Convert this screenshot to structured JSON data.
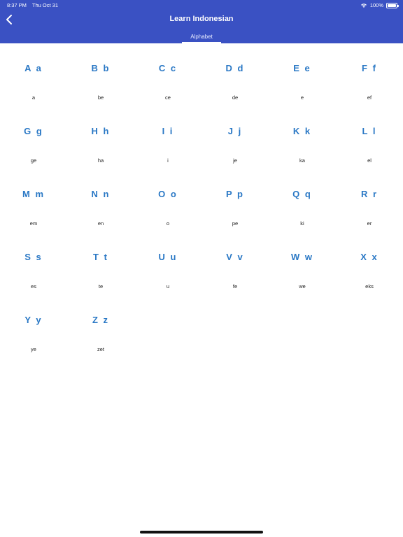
{
  "status": {
    "time": "8:37 PM",
    "date": "Thu Oct 31",
    "battery": "100%"
  },
  "header": {
    "title": "Learn Indonesian",
    "tab": "Alphabet"
  },
  "icons": {
    "back": "chevron-left-icon",
    "wifi": "wifi-icon",
    "battery": "battery-icon"
  },
  "colors": {
    "header_bg": "#3a51c3",
    "letter": "#2a78c5"
  },
  "alphabet": [
    {
      "letter": "A a",
      "pron": "a"
    },
    {
      "letter": "B b",
      "pron": "be"
    },
    {
      "letter": "C c",
      "pron": "ce"
    },
    {
      "letter": "D d",
      "pron": "de"
    },
    {
      "letter": "E e",
      "pron": "e"
    },
    {
      "letter": "F f",
      "pron": "ef"
    },
    {
      "letter": "G g",
      "pron": "ge"
    },
    {
      "letter": "H h",
      "pron": "ha"
    },
    {
      "letter": "I i",
      "pron": "i"
    },
    {
      "letter": "J j",
      "pron": "je"
    },
    {
      "letter": "K k",
      "pron": "ka"
    },
    {
      "letter": "L l",
      "pron": "el"
    },
    {
      "letter": "M m",
      "pron": "em"
    },
    {
      "letter": "N n",
      "pron": "en"
    },
    {
      "letter": "O o",
      "pron": "o"
    },
    {
      "letter": "P p",
      "pron": "pe"
    },
    {
      "letter": "Q q",
      "pron": "ki"
    },
    {
      "letter": "R r",
      "pron": "er"
    },
    {
      "letter": "S s",
      "pron": "es"
    },
    {
      "letter": "T t",
      "pron": "te"
    },
    {
      "letter": "U u",
      "pron": "u"
    },
    {
      "letter": "V v",
      "pron": "fe"
    },
    {
      "letter": "W w",
      "pron": "we"
    },
    {
      "letter": "X x",
      "pron": "eks"
    },
    {
      "letter": "Y y",
      "pron": "ye"
    },
    {
      "letter": "Z z",
      "pron": "zet"
    }
  ]
}
